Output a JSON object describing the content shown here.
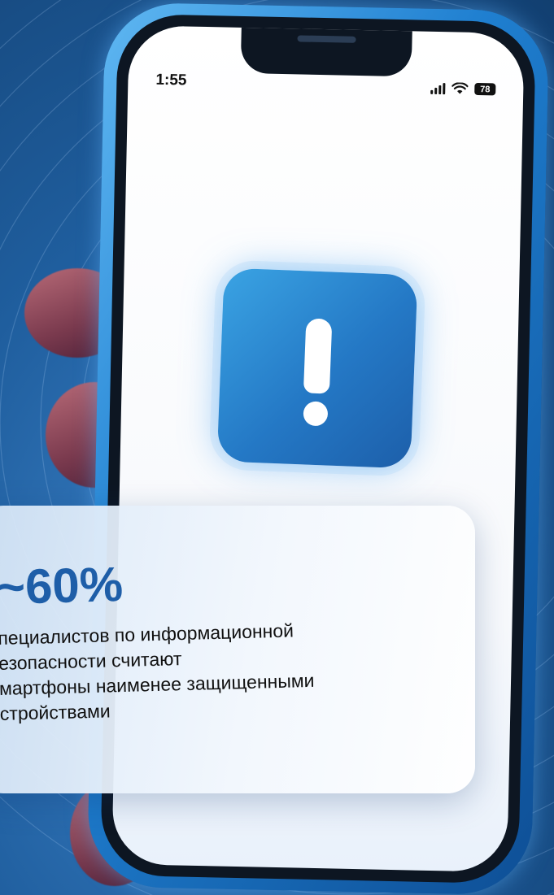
{
  "status_bar": {
    "time": "1:55",
    "battery": "78"
  },
  "stat": {
    "value": "~60%",
    "lines": [
      "пециалистов по информационной",
      "езопасности  считают",
      "мартфоны наименее защищенными",
      "стройствами"
    ]
  },
  "icons": {
    "alert": "exclamation-alert-icon",
    "signal": "cellular-signal-icon",
    "wifi": "wifi-icon",
    "battery": "battery-icon"
  },
  "colors": {
    "accent": "#1e5ea8",
    "background": "#1f5e9e",
    "phone_frame": "#1f7fd0",
    "alert_icon": "#2478c5"
  }
}
